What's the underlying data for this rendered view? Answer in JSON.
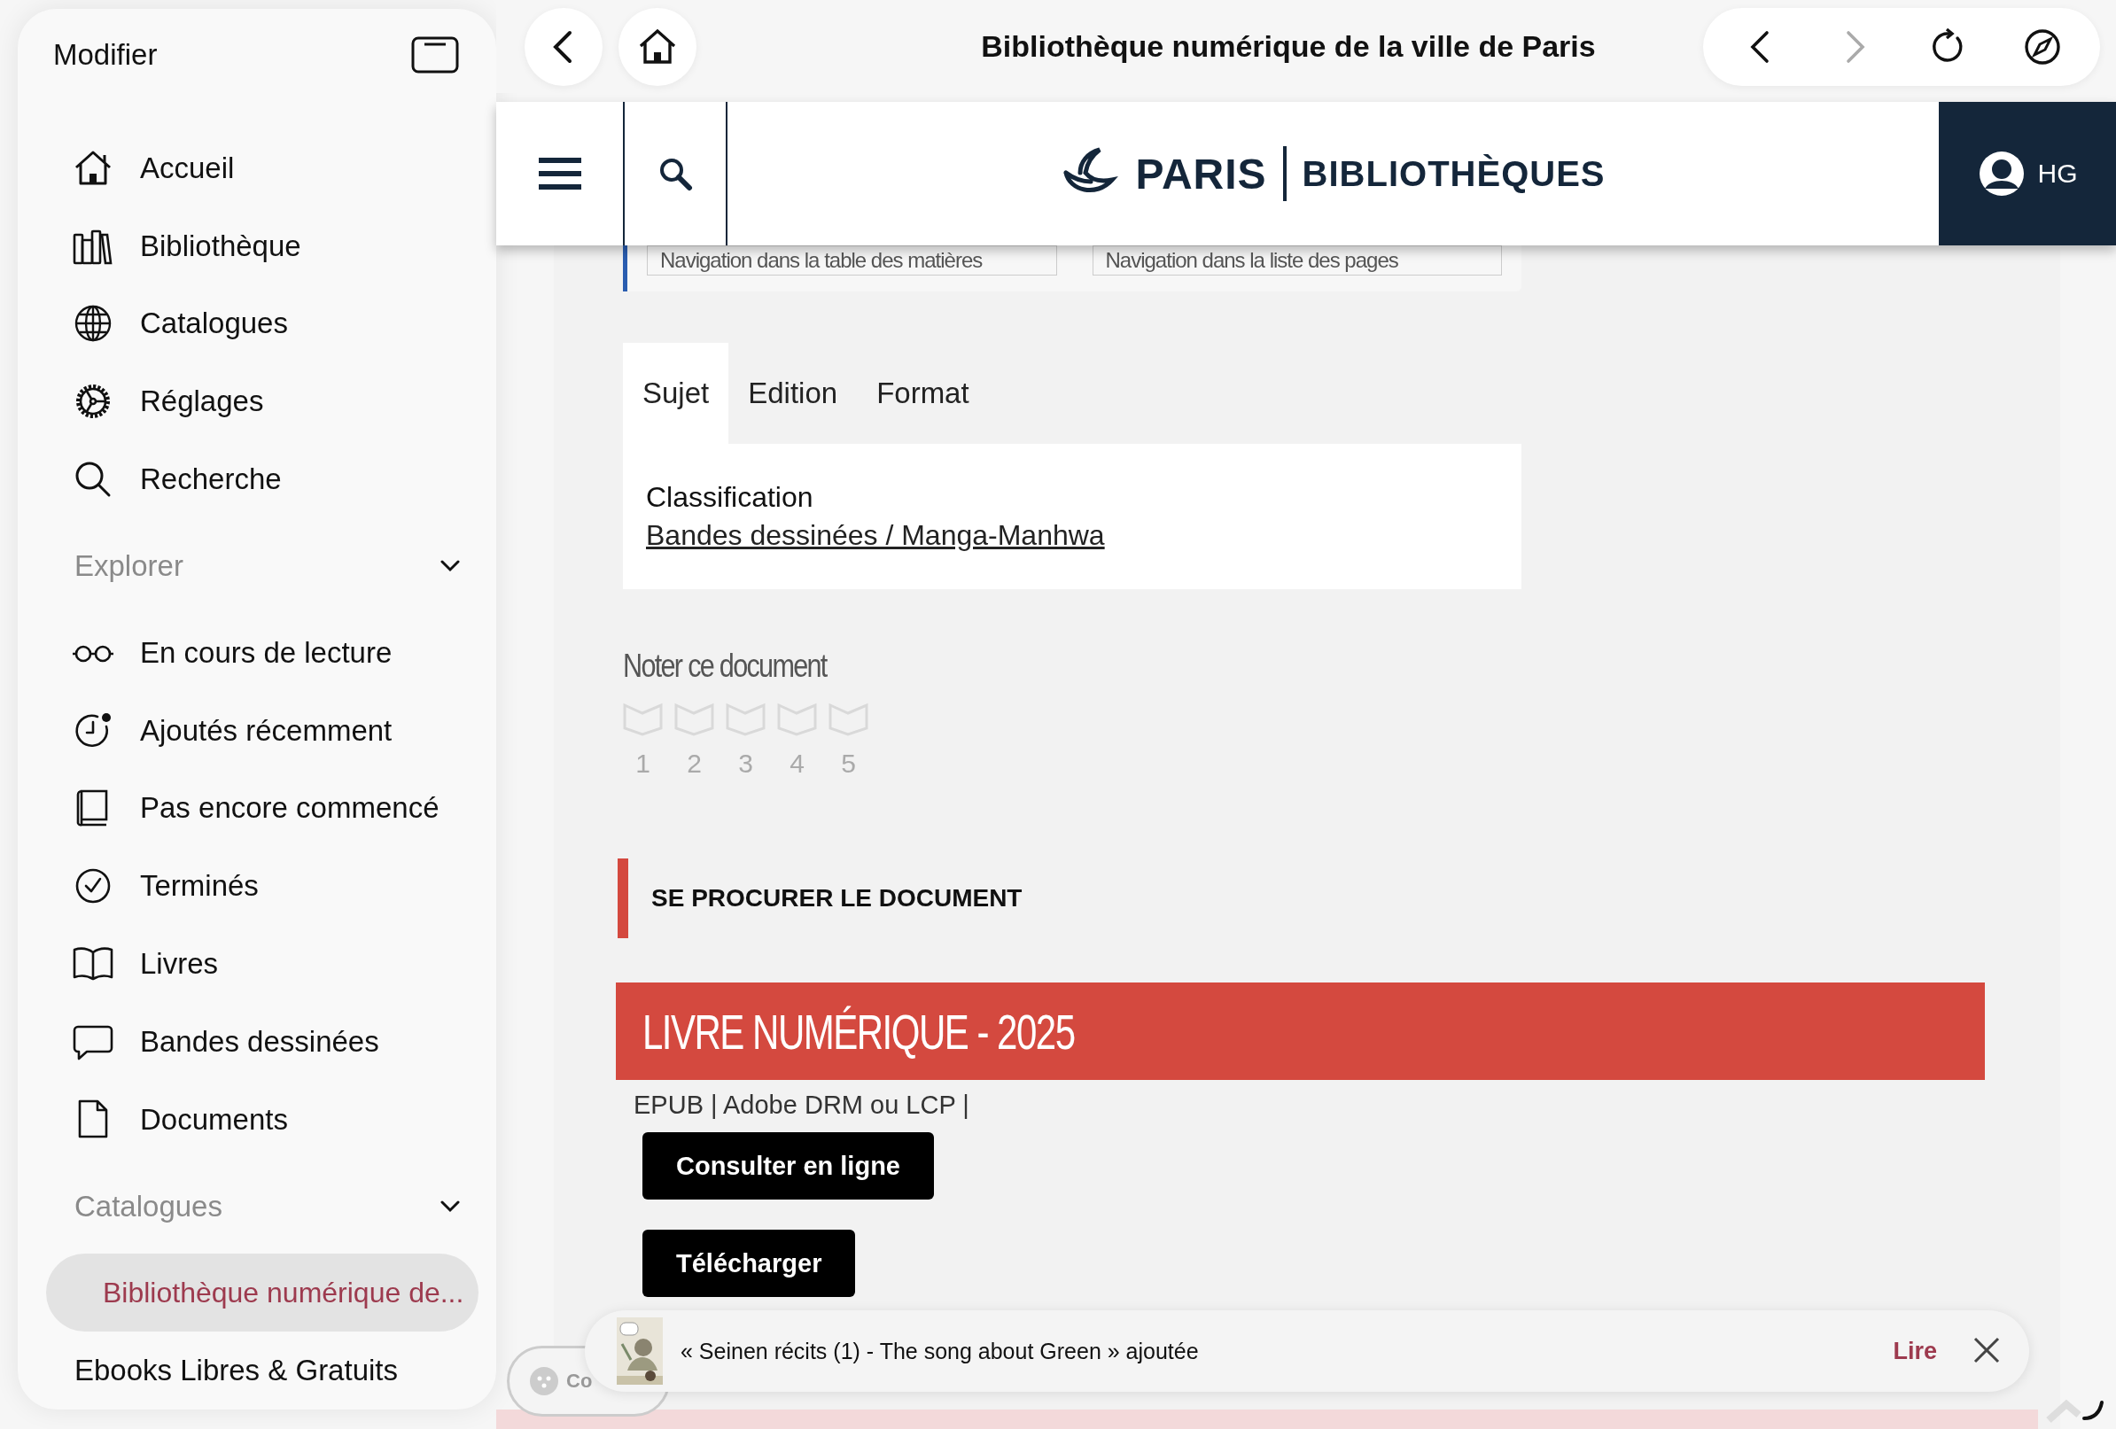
{
  "sidebar": {
    "edit_label": "Modifier",
    "groups": [
      {
        "items": [
          {
            "label": "Accueil",
            "selected": false
          },
          {
            "label": "Bibliothèque",
            "selected": false
          },
          {
            "label": "Catalogues",
            "selected": false
          },
          {
            "label": "Réglages",
            "selected": false
          },
          {
            "label": "Recherche",
            "selected": false
          }
        ]
      },
      {
        "heading": "Explorer",
        "expanded": true,
        "items": [
          {
            "label": "En cours de lecture",
            "selected": false
          },
          {
            "label": "Ajoutés récemment",
            "selected": false
          },
          {
            "label": "Pas encore commencé",
            "selected": false
          },
          {
            "label": "Terminés",
            "selected": false
          },
          {
            "label": "Livres",
            "selected": false
          },
          {
            "label": "Bandes dessinées",
            "selected": false
          },
          {
            "label": "Documents",
            "selected": false
          }
        ]
      },
      {
        "heading": "Catalogues",
        "expanded": true,
        "items": [
          {
            "label": "Bibliothèque numérique de...",
            "selected": true
          },
          {
            "label": "Ebooks Libres & Gratuits",
            "selected": false
          }
        ]
      }
    ]
  },
  "browser_bar": {
    "title": "Bibliothèque numérique de la ville de Paris",
    "forward_disabled": true
  },
  "site_header": {
    "logo_city": "PARIS",
    "logo_section": "BIBLIOTHÈQUES",
    "user_initials": "HG"
  },
  "navigation_fields": [
    "Navigation dans la table des matières",
    "Navigation dans la liste des pages"
  ],
  "tabs": [
    {
      "label": "Sujet",
      "selected": true
    },
    {
      "label": "Edition",
      "selected": false
    },
    {
      "label": "Format",
      "selected": false
    }
  ],
  "classification": {
    "label": "Classification",
    "link": "Bandes dessinées / Manga-Manhwa"
  },
  "rating": {
    "title": "Noter ce document",
    "stars": 0,
    "labels": [
      "1",
      "2",
      "3",
      "4",
      "5"
    ]
  },
  "section_heading": "SE PROCURER LE DOCUMENT",
  "offer": {
    "title": "LIVRE NUMÉRIQUE - 2025",
    "formats": "EPUB | Adobe DRM ou LCP |",
    "buttons": [
      "Consulter en ligne",
      "Télécharger"
    ]
  },
  "pill_label": "Co",
  "toast": {
    "message": "« Seinen récits (1) - The song about Green » ajoutée",
    "action": "Lire"
  }
}
